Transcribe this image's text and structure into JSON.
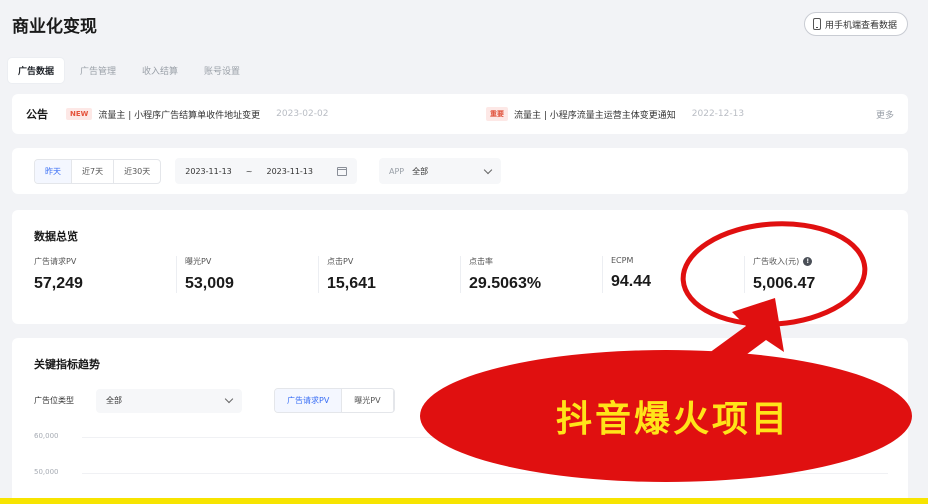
{
  "header": {
    "title": "商业化变现",
    "mobile_button_label": "用手机端查看数据"
  },
  "tabs": [
    {
      "label": "广告数据",
      "active": true
    },
    {
      "label": "广告管理",
      "active": false
    },
    {
      "label": "收入结算",
      "active": false
    },
    {
      "label": "账号设置",
      "active": false
    }
  ],
  "notice": {
    "title": "公告",
    "items": [
      {
        "badge": "NEW",
        "text": "流量主 | 小程序广告结算单收件地址变更",
        "date": "2023-02-02"
      },
      {
        "badge": "重要",
        "text": "流量主 | 小程序流量主运营主体变更通知",
        "date": "2022-12-13"
      }
    ],
    "more": "更多"
  },
  "filter": {
    "ranges": [
      "昨天",
      "近7天",
      "近30天"
    ],
    "active_range": "昨天",
    "start_date": "2023-11-13",
    "separator": "~",
    "end_date": "2023-11-13",
    "app_label": "APP",
    "app_value": "全部"
  },
  "overview": {
    "title": "数据总览",
    "metrics": [
      {
        "label": "广告请求PV",
        "value": "57,249"
      },
      {
        "label": "曝光PV",
        "value": "53,009"
      },
      {
        "label": "点击PV",
        "value": "15,641"
      },
      {
        "label": "点击率",
        "value": "29.5063%"
      },
      {
        "label": "ECPM",
        "value": "94.44"
      },
      {
        "label": "广告收入(元)",
        "value": "5,006.47"
      }
    ]
  },
  "trend": {
    "title": "关键指标趋势",
    "type_label": "广告位类型",
    "type_value": "全部",
    "metric_tabs": [
      "广告请求PV",
      "曝光PV"
    ],
    "y_ticks": [
      "60,000",
      "50,000"
    ]
  },
  "overlay": {
    "banner_text": "抖音爆火项目",
    "colors": {
      "red": "#e01010",
      "banner_text": "#ffe419",
      "strip": "#f7e400"
    }
  }
}
